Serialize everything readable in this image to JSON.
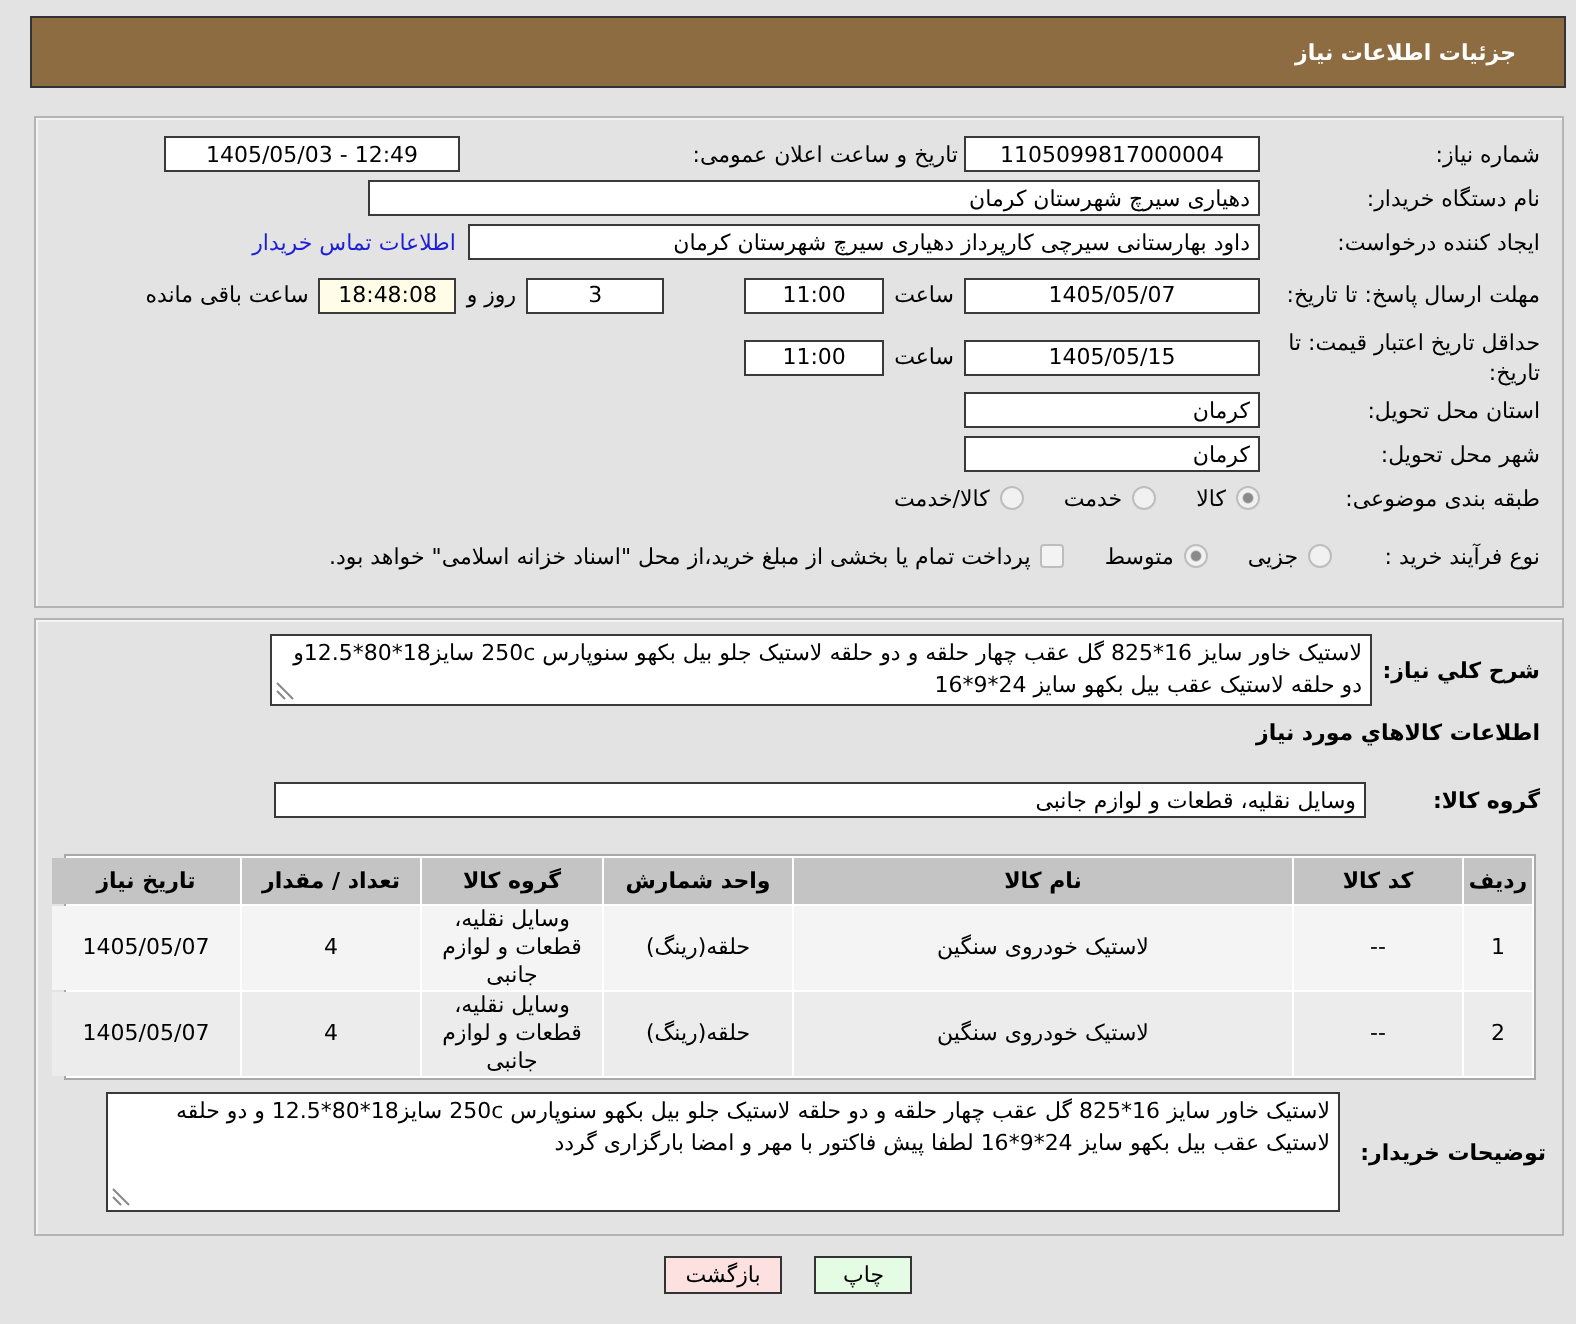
{
  "header": {
    "title": "جزئیات اطلاعات نیاز"
  },
  "need_info": {
    "need_number": {
      "label": "شماره نیاز:",
      "value": "1105099817000004"
    },
    "announcement": {
      "label": "تاریخ و ساعت اعلان عمومی:",
      "value": "1405/05/03 - 12:49"
    },
    "buyer_org": {
      "label": "نام دستگاه خریدار:",
      "value": "دهیاری سیرچ شهرستان کرمان"
    },
    "requester": {
      "label": "ایجاد کننده درخواست:",
      "value": "داود بهارستانی سیرچی کارپرداز دهیاری سیرچ شهرستان کرمان",
      "contact_link": "اطلاعات تماس خریدار"
    },
    "response_deadline": {
      "label": "مهلت ارسال پاسخ: تا تاریخ:",
      "date": "1405/05/07",
      "time_label": "ساعت",
      "time": "11:00",
      "days": "3",
      "days_label": "روز و",
      "remaining_time": "18:48:08",
      "remaining_label": "ساعت باقی مانده"
    },
    "price_validity": {
      "label": "حداقل تاریخ اعتبار قیمت: تا تاریخ:",
      "date": "1405/05/15",
      "time_label": "ساعت",
      "time": "11:00"
    },
    "delivery_province": {
      "label": "استان محل تحویل:",
      "value": "کرمان"
    },
    "delivery_city": {
      "label": "شهر محل تحویل:",
      "value": "کرمان"
    },
    "subject_category": {
      "label": "طبقه بندی موضوعی:",
      "options": [
        {
          "label": "کالا",
          "selected": true
        },
        {
          "label": "خدمت",
          "selected": false
        },
        {
          "label": "کالا/خدمت",
          "selected": false
        }
      ]
    },
    "purchase_process": {
      "label": "نوع فرآیند خرید :",
      "options": [
        {
          "label": "جزیی",
          "selected": false
        },
        {
          "label": "متوسط",
          "selected": true
        }
      ],
      "treasury_payment": {
        "label": "پرداخت تمام یا بخشی از مبلغ خرید،از محل \"اسناد خزانه اسلامی\" خواهد بود.",
        "checked": false
      }
    }
  },
  "need_details": {
    "description": {
      "label": "شرح کلي نیاز:",
      "value": "لاستیک خاور سایز 16*825 گل عقب چهار حلقه و دو حلقه لاستیک جلو بیل بکهو  سنوپارس 250c سایز18*80*12.5و دو حلقه لاستیک عقب بیل بکهو سایز 24*9*16"
    },
    "goods_heading": "اطلاعات کالاهاي مورد نیاز",
    "goods_group": {
      "label": "گروه کالا:",
      "value": "وسایل نقلیه، قطعات و لوازم جانبی"
    },
    "table": {
      "columns": [
        "ردیف",
        "کد کالا",
        "نام کالا",
        "واحد شمارش",
        "گروه کالا",
        "تعداد / مقدار",
        "تاریخ نیاز"
      ],
      "rows": [
        {
          "cells": [
            "1",
            "--",
            "لاستیک خودروی سنگین",
            "حلقه(رینگ)",
            "وسایل نقلیه، قطعات و لوازم جانبی",
            "4",
            "1405/05/07"
          ]
        },
        {
          "cells": [
            "2",
            "--",
            "لاستیک خودروی سنگین",
            "حلقه(رینگ)",
            "وسایل نقلیه، قطعات و لوازم جانبی",
            "4",
            "1405/05/07"
          ]
        }
      ]
    },
    "buyer_notes": {
      "label": "توضیحات خریدار:",
      "value": "لاستیک خاور سایز 16*825 گل عقب چهار حلقه و دو حلقه لاستیک جلو بیل بکهو  سنوپارس 250c سایز18*80*12.5 و دو حلقه لاستیک عقب بیل بکهو سایز 24*9*16 لطفا پیش فاکتور با مهر و امضا بارگزاری گردد"
    }
  },
  "buttons": [
    {
      "label": "چاپ",
      "kind": "print"
    },
    {
      "label": "بازگشت",
      "kind": "back"
    }
  ]
}
